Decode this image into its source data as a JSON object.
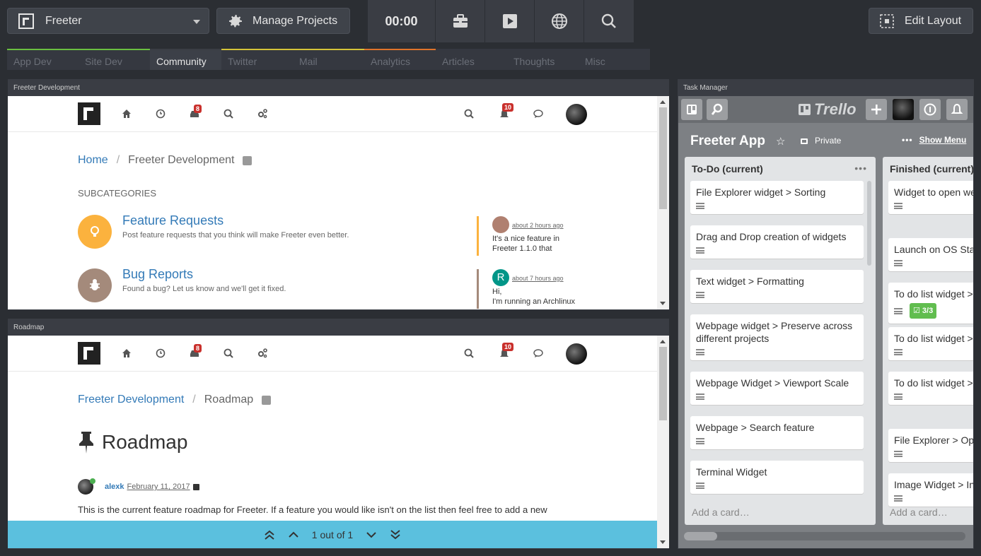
{
  "toolbar": {
    "project_name": "Freeter",
    "manage_projects": "Manage Projects",
    "timer": "00:00",
    "edit_layout": "Edit Layout"
  },
  "tabs": [
    {
      "label": "App Dev",
      "color": "#6abf40",
      "active": false
    },
    {
      "label": "Site Dev",
      "color": "#6abf40",
      "active": false
    },
    {
      "label": "Community",
      "color": "#3a3d44",
      "active": true
    },
    {
      "label": "Twitter",
      "color": "#d4c438",
      "active": false
    },
    {
      "label": "Mail",
      "color": "#d4c438",
      "active": false
    },
    {
      "label": "Analytics",
      "color": "#e0742b",
      "active": false
    },
    {
      "label": "Articles",
      "color": "#353840",
      "active": false
    },
    {
      "label": "Thoughts",
      "color": "#353840",
      "active": false
    },
    {
      "label": "Misc",
      "color": "#353840",
      "active": false
    }
  ],
  "panel1": {
    "title": "Freeter Development",
    "nav": {
      "badge_unread": "8",
      "badge_notif": "10"
    },
    "breadcrumb": {
      "home": "Home",
      "current": "Freeter Development"
    },
    "subcategories_heading": "SUBCATEGORIES",
    "categories": [
      {
        "title": "Feature Requests",
        "desc": "Post feature requests that you think will make Freeter even better.",
        "icon_color": "#fbb23e",
        "bar_color": "#fbb23e",
        "teaser_time": "about 2 hours ago",
        "teaser_msg": "It's a nice feature in Freeter 1.1.0 that",
        "teaser_avatar_color": "#b08070"
      },
      {
        "title": "Bug Reports",
        "desc": "Found a bug? Let us know and we'll get it fixed.",
        "icon_color": "#a48a7b",
        "bar_color": "#a48a7b",
        "teaser_time": "about 7 hours ago",
        "teaser_msg": "Hi,\nI'm running an Archlinux",
        "teaser_avatar_letter": "R",
        "teaser_avatar_color": "#009688"
      }
    ]
  },
  "panel2": {
    "title": "Roadmap",
    "nav": {
      "badge_unread": "8",
      "badge_notif": "10"
    },
    "breadcrumb": {
      "parent": "Freeter Development",
      "current": "Roadmap"
    },
    "heading": "Roadmap",
    "author": "alexk",
    "date": "February 11, 2017",
    "text": "This is the current feature roadmap for Freeter. If a feature you would like isn't on the list then feel free to add a new",
    "findbar": {
      "count": "1 out of 1"
    }
  },
  "panel3": {
    "title": "Task Manager",
    "trello": {
      "logo": "Trello",
      "board_title": "Freeter App",
      "privacy": "Private",
      "show_menu": "Show Menu",
      "lists": [
        {
          "title": "To-Do (current)",
          "cards": [
            "File Explorer widget > Sorting",
            "Drag and Drop creation of widgets",
            "Text widget > Formatting",
            "Webpage widget > Preserve across different projects",
            "Webpage Widget > Viewport Scale",
            "Webpage > Search feature",
            "Terminal Widget"
          ],
          "add_card": "Add a card…"
        },
        {
          "title": "Finished (current)",
          "cards": [
            "Widget to open web webbrowser",
            "Launch on OS Start",
            "To do list widget >",
            "To do list widget >",
            "To do list widget > header",
            "File Explorer > Op",
            "Image Widget > In"
          ],
          "checklist": "3/3",
          "add_card": "Add a card…"
        }
      ]
    }
  }
}
